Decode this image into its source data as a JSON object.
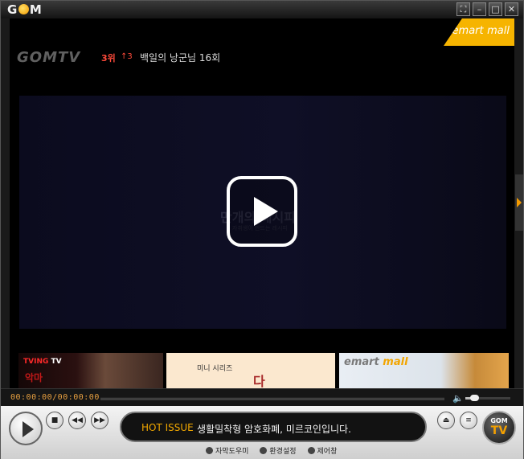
{
  "app": {
    "logo": "GOM"
  },
  "window_buttons": {
    "fullscreen": "⛶",
    "minimize": "–",
    "maximize": "□",
    "close": "✕"
  },
  "video": {
    "ad_badge": {
      "brand": "emart",
      "brand2": "mall"
    },
    "watermark": "GOMTV",
    "rank": "3위",
    "rank_change": "↑3",
    "title": "백일의 낭군님 16회",
    "stage_text": "만개의 레시피",
    "stage_sub": "자취생이 만드는 레시피"
  },
  "thumbnails": [
    {
      "label_brand": "TVING",
      "label_tv": "TV",
      "subtitle": "악마"
    },
    {
      "label": "미니 시리즈",
      "subtitle": "다"
    },
    {
      "label_brand": "emart",
      "label_mall": "mall"
    }
  ],
  "playback": {
    "time": "00:00:00/00:00:00",
    "volume_fraction": 0.2
  },
  "controls": {
    "play": "play",
    "stop": "■",
    "prev": "◀◀",
    "next": "▶▶",
    "eject": "⏏",
    "menu": "≡"
  },
  "ticker": {
    "hot_label": "HOT ISSUE",
    "message": "생활밀착형 암호화폐, 미르코인입니다."
  },
  "gom_logo": {
    "top": "GOM",
    "bottom": "TV"
  },
  "links": [
    "자막도우미",
    "환경설정",
    "제어창"
  ],
  "colors": {
    "accent": "#f39a00",
    "ad": "#f6b400",
    "rank": "#ff4a3a"
  }
}
